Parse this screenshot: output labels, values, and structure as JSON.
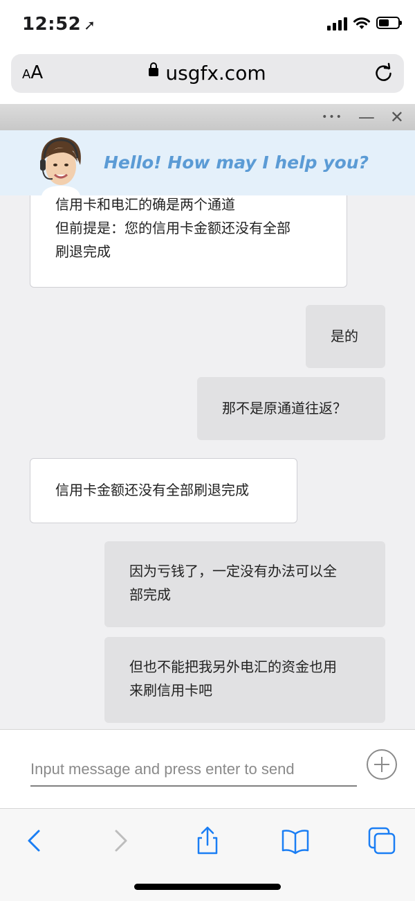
{
  "status_bar": {
    "time": "12:52",
    "location_icon": "location-arrow-icon",
    "icons": [
      "cellular-signal-icon",
      "wifi-icon",
      "battery-icon"
    ]
  },
  "browser": {
    "text_size_label_small": "A",
    "text_size_label_large": "A",
    "url": "usgfx.com",
    "secure_icon": "lock-icon",
    "reload_icon": "reload-icon"
  },
  "chat_widget": {
    "controls": {
      "more": "•••",
      "minimize": "—",
      "close": "✕"
    },
    "banner_text": "Hello! How may I help you?",
    "messages": [
      {
        "from": "agent",
        "lines": [
          "信用卡和电汇的确是两个通道",
          "但前提是：您的信用卡金额还没有全部",
          "刷退完成"
        ]
      },
      {
        "from": "user",
        "lines": [
          "是的"
        ]
      },
      {
        "from": "user",
        "lines": [
          "那不是原通道往返？"
        ]
      },
      {
        "from": "agent",
        "lines": [
          "信用卡金额还没有全部刷退完成"
        ]
      },
      {
        "from": "user",
        "lines": [
          "因为亏钱了，一定没有办法可以全",
          "部完成"
        ]
      },
      {
        "from": "user",
        "lines": [
          "但也不能把我另外电汇的资金也用",
          "来刷信用卡吧"
        ]
      }
    ],
    "input_placeholder": "Input message and press enter to send"
  },
  "toolbar": {
    "buttons": [
      "back-icon",
      "forward-icon",
      "share-icon",
      "bookmarks-icon",
      "tabs-icon"
    ]
  },
  "colors": {
    "ios_blue": "#1a7ef4",
    "banner_text": "#5b9bd5",
    "agent_bubble": "#ffffff",
    "user_bubble": "#e1e1e3"
  }
}
